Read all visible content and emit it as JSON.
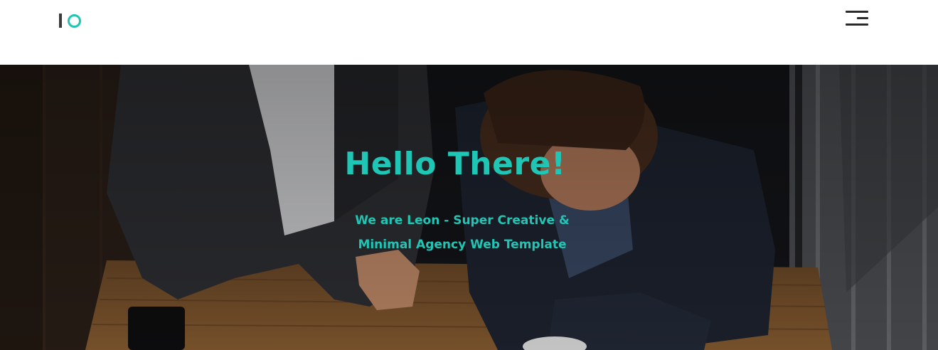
{
  "header": {
    "logo_icon": "io-logo-icon",
    "menu_icon": "hamburger-menu-icon"
  },
  "hero": {
    "title": "Hello There!",
    "subtitle_line1": "We are Leon - Super Creative &",
    "subtitle_line2": "Minimal Agency Web Template",
    "image": "photo-two-men-at-wooden-table"
  },
  "colors": {
    "accent": "#1fc6b5",
    "header_bg": "#ffffff",
    "logo_bar": "#3a3a3a",
    "menu_lines": "#2a2a2a"
  }
}
